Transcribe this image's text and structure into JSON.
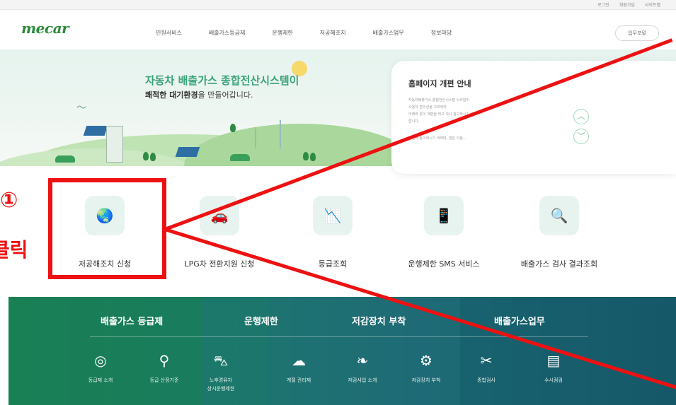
{
  "util_links": [
    "로그인",
    "회원가입",
    "사이트맵"
  ],
  "logo": "mecar",
  "nav": [
    "민원서비스",
    "배출가스등급제",
    "운행제한",
    "저공해조치",
    "배출가스업무",
    "정보마당"
  ],
  "biz_button": "업무포털",
  "hero": {
    "title": "자동차 배출가스 종합전산시스템이",
    "subtitle_bold": "쾌적한 대기환경",
    "subtitle_rest": "을 만들어갑니다."
  },
  "notice": {
    "title": "홈페이지 개편 안내",
    "lines": [
      "자동차배출가스 종합전산시스템 누리집이",
      "사용자 편의성을 고려하여",
      "아래와 같이 개편을 하고 아니 참고하시기 바",
      "랍니다.",
      "이용에 참고하시기 바라며, 많은 이용..."
    ],
    "up_icon": "chevron-up-icon",
    "down_icon": "chevron-down-icon"
  },
  "services": [
    {
      "label": "저공해조치 신청",
      "icon": "earth-plant-icon"
    },
    {
      "label": "LPG차 전환지원 신청",
      "icon": "car-icon"
    },
    {
      "label": "등급조회",
      "icon": "grade-chart-icon"
    },
    {
      "label": "운행제한 SMS 서비스",
      "icon": "phone-sms-icon"
    },
    {
      "label": "배출가스 검사 결과조회",
      "icon": "inspection-search-icon"
    }
  ],
  "annotation": {
    "step_number": "①",
    "step_word": "클릭",
    "color": "#ee1111"
  },
  "bottom_menu": {
    "categories": [
      "배출가스 등급제",
      "운행제한",
      "저감장치 부착",
      "배출가스업무"
    ],
    "items": [
      {
        "label": "등급제 소개",
        "icon": "gauge-icon"
      },
      {
        "label": "등급 산정기준",
        "icon": "search-icon"
      },
      {
        "label": "노후경유차\n상시운행제한",
        "icon": "car-front-icon"
      },
      {
        "label": "계절 관리제",
        "icon": "weather-icon"
      },
      {
        "label": "저감사업 소개",
        "icon": "eco-car-icon"
      },
      {
        "label": "저감장치 부착",
        "icon": "filter-device-icon"
      },
      {
        "label": "종합검사",
        "icon": "tools-icon"
      },
      {
        "label": "수시점검",
        "icon": "document-icon"
      }
    ]
  },
  "colors": {
    "brand_green": "#2a8a3a",
    "hero_title": "#3aa37a",
    "bottom_green": "#1f8a5a",
    "bottom_teal": "#1a5e6e"
  }
}
